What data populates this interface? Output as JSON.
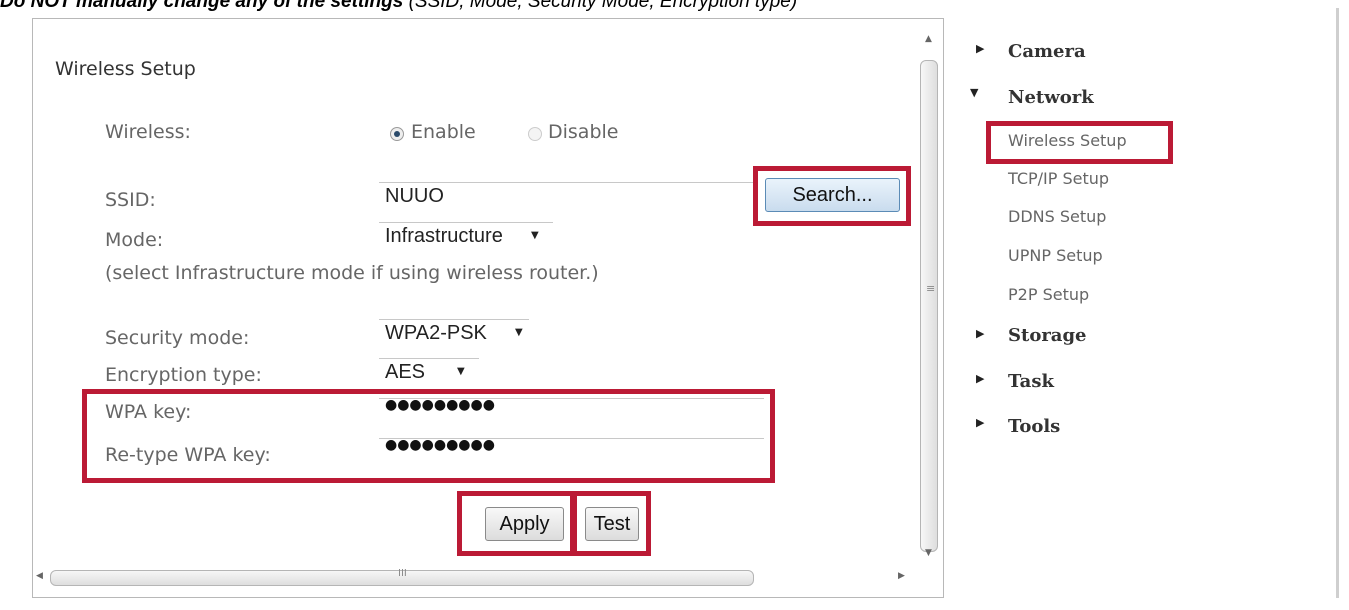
{
  "caption": {
    "bold": "Do NOT manually change any of the settings",
    "rest": " (SSID, Mode, Security Mode, Encryption type)"
  },
  "form": {
    "title": "Wireless Setup",
    "wireless_label": "Wireless:",
    "wireless_options": {
      "enable": "Enable",
      "disable": "Disable",
      "selected": "Enable"
    },
    "ssid_label": "SSID:",
    "ssid_value": "NUUO",
    "search_button": "Search...",
    "mode_label": "Mode:",
    "mode_value": "Infrastructure",
    "mode_hint": "(select Infrastructure mode if using wireless router.)",
    "security_label": "Security mode:",
    "security_value": "WPA2-PSK",
    "encryption_label": "Encryption type:",
    "encryption_value": "AES",
    "wpa_key_label": "WPA key:",
    "wpa_key_value": "●●●●●●●●●",
    "retype_label": "Re-type WPA key:",
    "retype_value": "●●●●●●●●●",
    "apply_button": "Apply",
    "test_button": "Test"
  },
  "scrollbar": {
    "grip_v": "≡",
    "grip_h": "III"
  },
  "nav": {
    "items": [
      {
        "label": "Camera",
        "expanded": false
      },
      {
        "label": "Network",
        "expanded": true
      },
      {
        "label": "Storage",
        "expanded": false
      },
      {
        "label": "Task",
        "expanded": false
      },
      {
        "label": "Tools",
        "expanded": false
      }
    ],
    "network_sub": [
      "Wireless Setup",
      "TCP/IP Setup",
      "DDNS Setup",
      "UPNP Setup",
      "P2P Setup"
    ],
    "active_sub": "Wireless Setup"
  },
  "colors": {
    "highlight": "#bb1a35",
    "panel_border": "#b8b8b8"
  }
}
